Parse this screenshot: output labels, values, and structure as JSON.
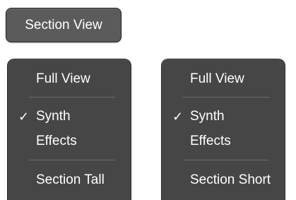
{
  "section_button": {
    "label": "Section View"
  },
  "menus": [
    {
      "items": [
        {
          "label": "Full View"
        },
        {
          "label": "Synth",
          "checked": true,
          "check_mark": "✓"
        },
        {
          "label": "Effects"
        },
        {
          "label": "Section Tall"
        }
      ]
    },
    {
      "items": [
        {
          "label": "Full View"
        },
        {
          "label": "Synth",
          "checked": true,
          "check_mark": "✓"
        },
        {
          "label": "Effects"
        },
        {
          "label": "Section Short"
        }
      ]
    }
  ],
  "colors": {
    "button_bg": "#5b5b5b",
    "menu_bg": "#464646",
    "text": "#ffffff",
    "separator": "#6a6a6a"
  }
}
